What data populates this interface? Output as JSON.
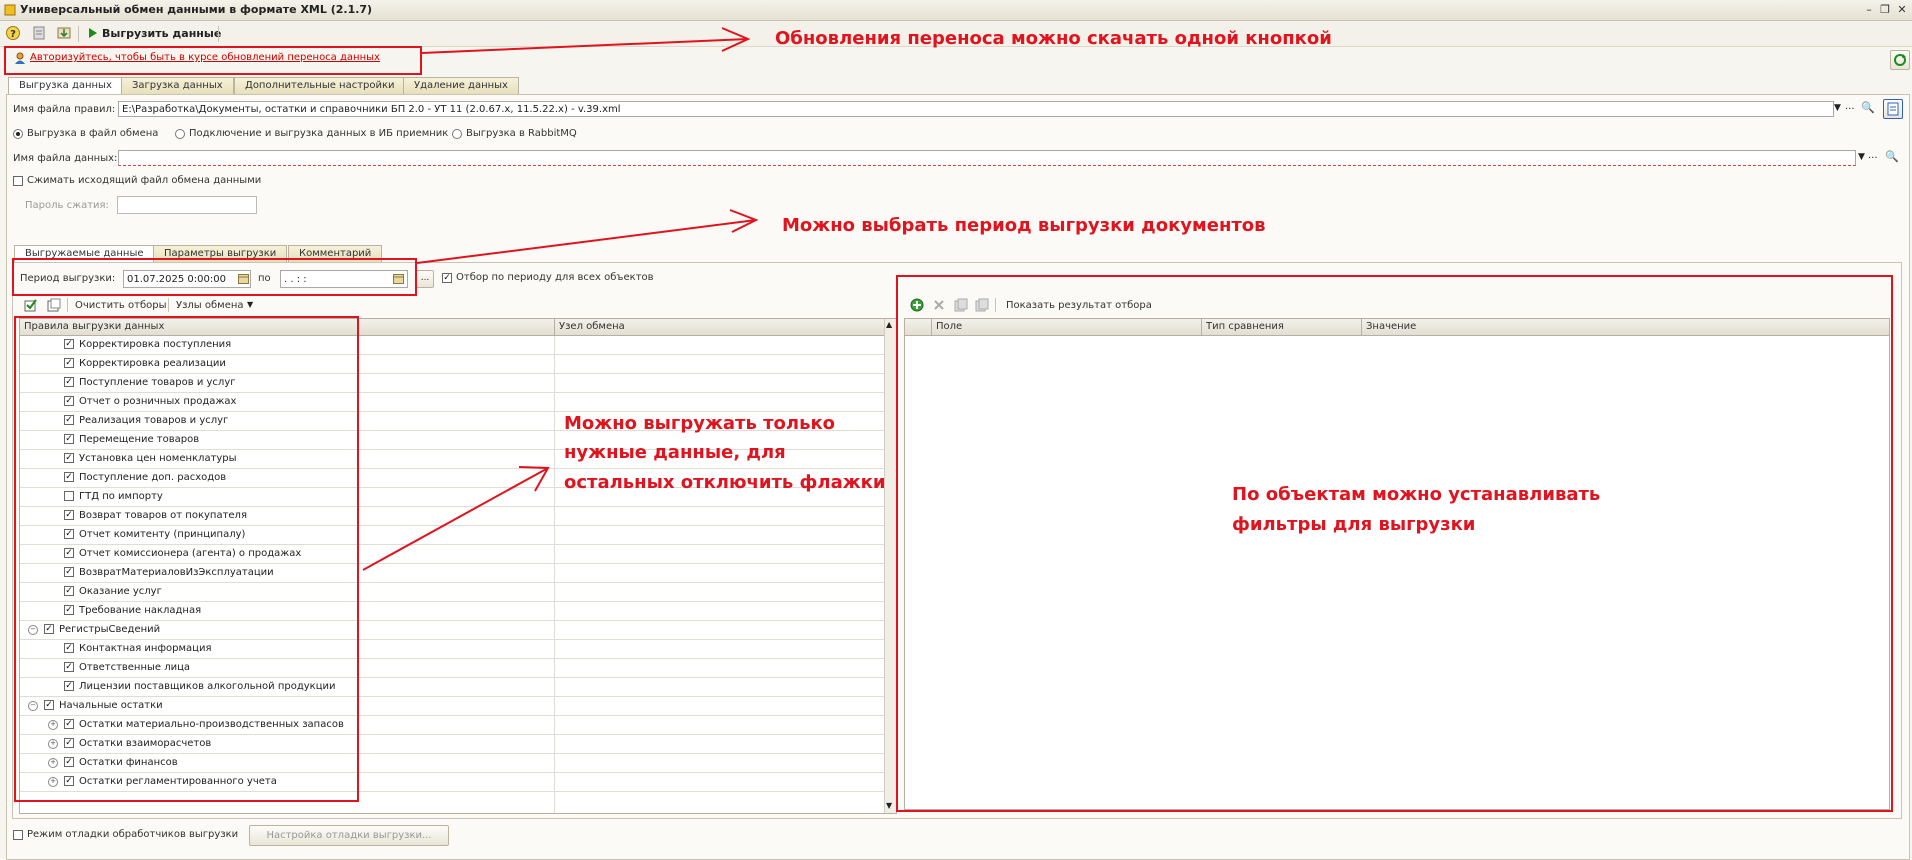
{
  "window": {
    "title": "Универсальный обмен данными в формате XML (2.1.7)"
  },
  "toolbar": {
    "export_label": "Выгрузить данные"
  },
  "auth": {
    "link": "Авторизуйтесь, чтобы быть в курсе обновлений переноса данных"
  },
  "main_tabs": [
    {
      "label": "Выгрузка данных"
    },
    {
      "label": "Загрузка данных"
    },
    {
      "label": "Дополнительные настройки"
    },
    {
      "label": "Удаление данных"
    }
  ],
  "rules_file": {
    "label": "Имя файла правил:",
    "value": "E:\\Разработка\\Документы, остатки и справочники БП 2.0 - УТ 11 (2.0.67.x, 11.5.22.x) - v.39.xml"
  },
  "export_mode": {
    "options": [
      {
        "label": "Выгрузка в файл обмена",
        "selected": true
      },
      {
        "label": "Подключение и выгрузка данных в ИБ приемник",
        "selected": false
      },
      {
        "label": "Выгрузка в RabbitMQ",
        "selected": false
      }
    ]
  },
  "data_file": {
    "label": "Имя файла данных:",
    "value": ""
  },
  "compress": {
    "label": "Сжимать исходящий файл обмена данными",
    "checked": false
  },
  "password": {
    "label": "Пароль сжатия:",
    "value": ""
  },
  "sub_tabs": [
    {
      "label": "Выгружаемые данные"
    },
    {
      "label": "Параметры выгрузки"
    },
    {
      "label": "Комментарий"
    }
  ],
  "period": {
    "label": "Период выгрузки:",
    "from": "01.07.2025  0:00:00",
    "to_label": "по",
    "to": "  .  .       :  :",
    "dots": "...",
    "filter_all_label": "Отбор по периоду для всех объектов",
    "filter_all_checked": true
  },
  "tree_toolbar": {
    "clear_label": "Очистить отборы",
    "nodes_label": "Узлы обмена"
  },
  "rules_grid": {
    "col1": "Правила выгрузки данных",
    "col2": "Узел обмена",
    "rows": [
      {
        "label": "Корректировка поступления",
        "checked": true,
        "level": 2
      },
      {
        "label": "Корректировка реализации",
        "checked": true,
        "level": 2
      },
      {
        "label": "Поступление товаров и услуг",
        "checked": true,
        "level": 2
      },
      {
        "label": "Отчет о розничных продажах",
        "checked": true,
        "level": 2
      },
      {
        "label": "Реализация товаров и услуг",
        "checked": true,
        "level": 2
      },
      {
        "label": "Перемещение товаров",
        "checked": true,
        "level": 2
      },
      {
        "label": "Установка цен номенклатуры",
        "checked": true,
        "level": 2
      },
      {
        "label": "Поступление доп. расходов",
        "checked": true,
        "level": 2
      },
      {
        "label": "ГТД по импорту",
        "checked": false,
        "level": 2
      },
      {
        "label": "Возврат товаров от покупателя",
        "checked": true,
        "level": 2
      },
      {
        "label": "Отчет комитенту (принципалу)",
        "checked": true,
        "level": 2
      },
      {
        "label": "Отчет комиссионера (агента) о продажах",
        "checked": true,
        "level": 2
      },
      {
        "label": "ВозвратМатериаловИзЭксплуатации",
        "checked": true,
        "level": 2
      },
      {
        "label": "Оказание услуг",
        "checked": true,
        "level": 2
      },
      {
        "label": "Требование накладная",
        "checked": true,
        "level": 2
      },
      {
        "label": "РегистрыСведений",
        "checked": true,
        "level": 1,
        "expander": "−"
      },
      {
        "label": "Контактная информация",
        "checked": true,
        "level": 2
      },
      {
        "label": "Ответственные лица",
        "checked": true,
        "level": 2
      },
      {
        "label": "Лицензии поставщиков алкогольной продукции",
        "checked": true,
        "level": 2
      },
      {
        "label": "Начальные остатки",
        "checked": true,
        "level": 1,
        "expander": "−"
      },
      {
        "label": "Остатки материально-производственных запасов",
        "checked": true,
        "level": 2,
        "expander": "+"
      },
      {
        "label": "Остатки взаиморасчетов",
        "checked": true,
        "level": 2,
        "expander": "+"
      },
      {
        "label": "Остатки финансов",
        "checked": true,
        "level": 2,
        "expander": "+"
      },
      {
        "label": "Остатки регламентированного учета",
        "checked": true,
        "level": 2,
        "expander": "+"
      }
    ]
  },
  "filter_panel": {
    "show_result_label": "Показать результат отбора",
    "columns": [
      "Поле",
      "Тип сравнения",
      "Значение"
    ]
  },
  "debug": {
    "mode_label": "Режим отладки обработчиков выгрузки",
    "settings_label": "Настройка отладки выгрузки..."
  },
  "annotations": {
    "a1": "Обновления переноса можно скачать одной кнопкой",
    "a2": "Можно выбрать период выгрузки документов",
    "a3_l1": "Можно выгружать только",
    "a3_l2": "нужные данные, для",
    "a3_l3": "остальных отключить флажки",
    "a4_l1": "По объектам можно устанавливать",
    "a4_l2": "фильтры для выгрузки"
  },
  "colors": {
    "annotation": "#e0141e",
    "tab_bg": "#ece5c4",
    "link": "#cc0000"
  }
}
